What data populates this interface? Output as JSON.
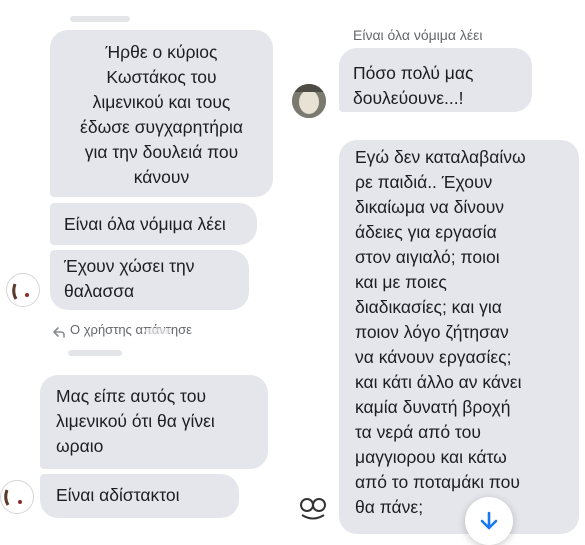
{
  "left": {
    "messages": [
      {
        "text": "Ήρθε ο κύριος\nΚωστάκος του\nλιμενικού και τους\nέδωσε συγχαρητήρια\nγια την δουλειά που\nκάνουν"
      },
      {
        "text": "Είναι όλα νόμιμα λέει"
      },
      {
        "text": "Έχουν χώσει την\nθαλασσα"
      },
      {
        "text": "Μας είπε αυτός του\nλιμενικού ότι θα γίνει\nωραιο"
      },
      {
        "text": "Είναι αδίστακτοι"
      }
    ],
    "reply_label": "Ο χρήστης                απάντησε"
  },
  "right": {
    "quoted": "Είναι όλα νόμιμα λέει",
    "messages": [
      {
        "text": "Πόσο πολύ μας\nδουλεύουνε...!"
      },
      {
        "text": "Εγώ δεν καταλαβαίνω\nρε παιδιά.. Έχουν\nδικαίωμα να δίνουν\nάδειες για εργασία\nστον αιγιαλό; ποιοι\nκαι με ποιες\nδιαδικασίες; και για\nποιον λόγο ζήτησαν\nνα κάνουν εργασίες;\nκαι κάτι άλλο αν κάνει\nκαμία δυνατή βροχή\nτα νερά από του\nμαγγιορου και κάτω\nαπό το ποταμάκι που\nθα πάνε;"
      }
    ]
  },
  "colors": {
    "bubble": "#e4e6eb",
    "meta": "#65676b",
    "accent": "#1877f2"
  },
  "icons": {
    "reply": "reply-arrow-icon",
    "scroll": "arrow-down-icon"
  }
}
